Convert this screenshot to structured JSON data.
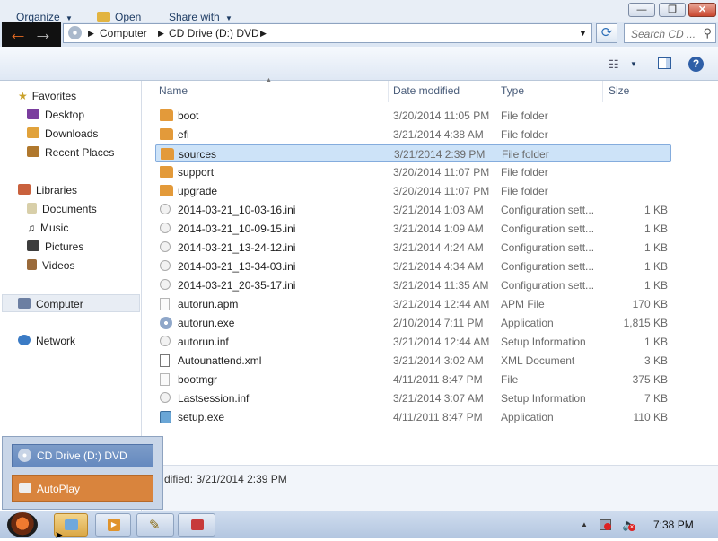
{
  "window": {
    "minimize": "—",
    "maximize": "❐",
    "close": "✕"
  },
  "address": {
    "crumbs": [
      "Computer",
      "CD Drive (D:) DVD"
    ],
    "search_placeholder": "Search CD ..."
  },
  "toolbar": {
    "organize": "Organize",
    "open": "Open",
    "share_with": "Share with"
  },
  "columns": {
    "name": "Name",
    "date": "Date modified",
    "type": "Type",
    "size": "Size"
  },
  "nav": {
    "favorites": "Favorites",
    "favorites_items": [
      "Desktop",
      "Downloads",
      "Recent Places"
    ],
    "libraries": "Libraries",
    "libraries_items": [
      "Documents",
      "Music",
      "Pictures",
      "Videos"
    ],
    "computer": "Computer",
    "network": "Network"
  },
  "files": [
    {
      "name": "boot",
      "date": "3/20/2014 11:05 PM",
      "type": "File folder",
      "size": "",
      "icon": "folder-icon"
    },
    {
      "name": "efi",
      "date": "3/21/2014 4:38 AM",
      "type": "File folder",
      "size": "",
      "icon": "folder-icon"
    },
    {
      "name": "sources",
      "date": "3/21/2014 2:39 PM",
      "type": "File folder",
      "size": "",
      "icon": "folder-icon",
      "selected": true
    },
    {
      "name": "support",
      "date": "3/20/2014 11:07 PM",
      "type": "File folder",
      "size": "",
      "icon": "folder-icon"
    },
    {
      "name": "upgrade",
      "date": "3/20/2014 11:07 PM",
      "type": "File folder",
      "size": "",
      "icon": "folder-icon"
    },
    {
      "name": "2014-03-21_10-03-16.ini",
      "date": "3/21/2014 1:03 AM",
      "type": "Configuration sett...",
      "size": "1 KB",
      "icon": "gear-file-icon"
    },
    {
      "name": "2014-03-21_10-09-15.ini",
      "date": "3/21/2014 1:09 AM",
      "type": "Configuration sett...",
      "size": "1 KB",
      "icon": "gear-file-icon"
    },
    {
      "name": "2014-03-21_13-24-12.ini",
      "date": "3/21/2014 4:24 AM",
      "type": "Configuration sett...",
      "size": "1 KB",
      "icon": "gear-file-icon"
    },
    {
      "name": "2014-03-21_13-34-03.ini",
      "date": "3/21/2014 4:34 AM",
      "type": "Configuration sett...",
      "size": "1 KB",
      "icon": "gear-file-icon"
    },
    {
      "name": "2014-03-21_20-35-17.ini",
      "date": "3/21/2014 11:35 AM",
      "type": "Configuration sett...",
      "size": "1 KB",
      "icon": "gear-file-icon"
    },
    {
      "name": "autorun.apm",
      "date": "3/21/2014 12:44 AM",
      "type": "APM File",
      "size": "170 KB",
      "icon": "blank-file-icon"
    },
    {
      "name": "autorun.exe",
      "date": "2/10/2014 7:11 PM",
      "type": "Application",
      "size": "1,815 KB",
      "icon": "disc-app-icon"
    },
    {
      "name": "autorun.inf",
      "date": "3/21/2014 12:44 AM",
      "type": "Setup Information",
      "size": "1 KB",
      "icon": "gear-file-icon"
    },
    {
      "name": "Autounattend.xml",
      "date": "3/21/2014 3:02 AM",
      "type": "XML Document",
      "size": "3 KB",
      "icon": "xml-file-icon"
    },
    {
      "name": "bootmgr",
      "date": "4/11/2011 8:47 PM",
      "type": "File",
      "size": "375 KB",
      "icon": "blank-file-icon"
    },
    {
      "name": "Lastsession.inf",
      "date": "3/21/2014 3:07 AM",
      "type": "Setup Information",
      "size": "7 KB",
      "icon": "gear-file-icon"
    },
    {
      "name": "setup.exe",
      "date": "4/11/2011 8:47 PM",
      "type": "Application",
      "size": "110 KB",
      "icon": "setup-app-icon"
    }
  ],
  "details": {
    "modified_text": "dified: 3/21/2014 2:39 PM"
  },
  "popup": {
    "drive": "CD Drive (D:) DVD",
    "autoplay": "AutoPlay"
  },
  "taskbar": {
    "clock": "7:38 PM"
  },
  "colors": {
    "folder": "#e39a3a",
    "accent": "#d9843d",
    "selection": "#cde3f8"
  }
}
